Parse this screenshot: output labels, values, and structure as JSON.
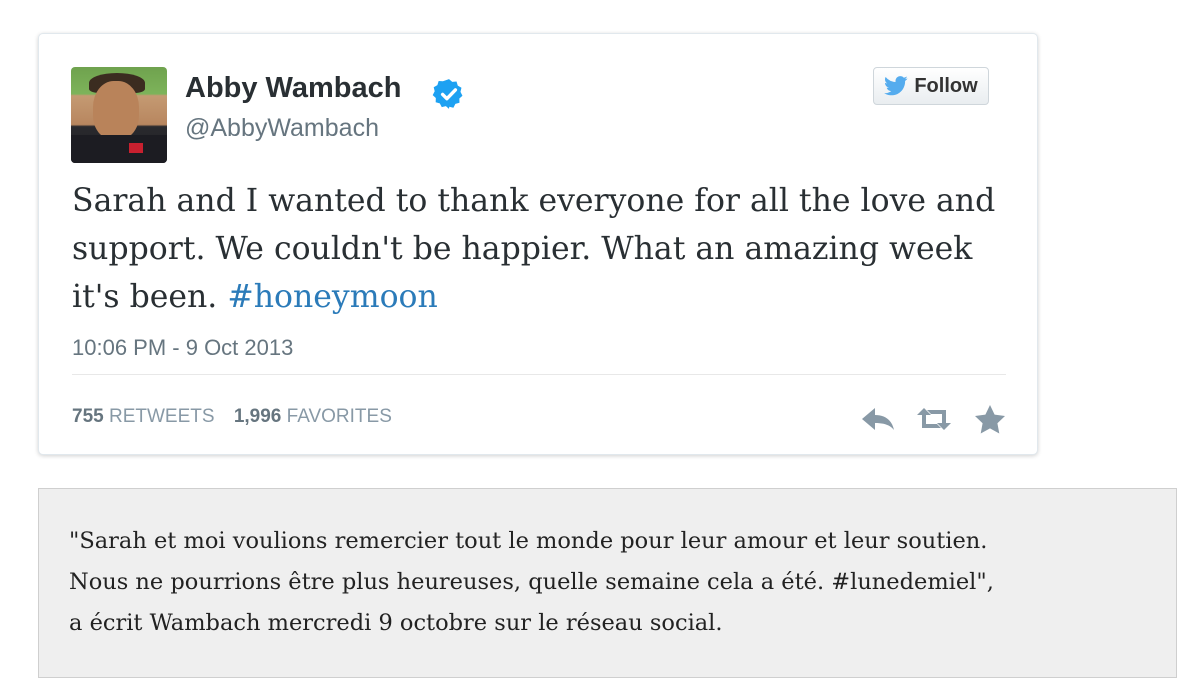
{
  "tweet": {
    "author_name": "Abby Wambach",
    "handle": "@AbbyWambach",
    "follow_label": "Follow",
    "text": "Sarah and I wanted to thank everyone for all the love and support. We couldn't be happier. What an amazing week it's been.",
    "hashtag": "#honeymoon",
    "timestamp": "10:06 PM - 9 Oct 2013",
    "retweets_count": "755",
    "retweets_label": "RETWEETS",
    "favorites_count": "1,996",
    "favorites_label": "FAVORITES",
    "icons": {
      "verified": "verified-badge-icon",
      "follow": "twitter-bird-icon",
      "reply": "reply-icon",
      "retweet": "retweet-icon",
      "favorite": "star-icon"
    },
    "colors": {
      "verified": "#1da1f2",
      "hashtag": "#2b7bb9",
      "icon_gray": "#8899a6"
    }
  },
  "translation": {
    "lines": [
      "\"Sarah et moi voulions remercier tout le monde pour leur amour et leur soutien.",
      "Nous ne pourrions être plus heureuses, quelle semaine cela a été. #lunedemiel\",",
      "a écrit Wambach mercredi 9 octobre sur le réseau social."
    ]
  }
}
